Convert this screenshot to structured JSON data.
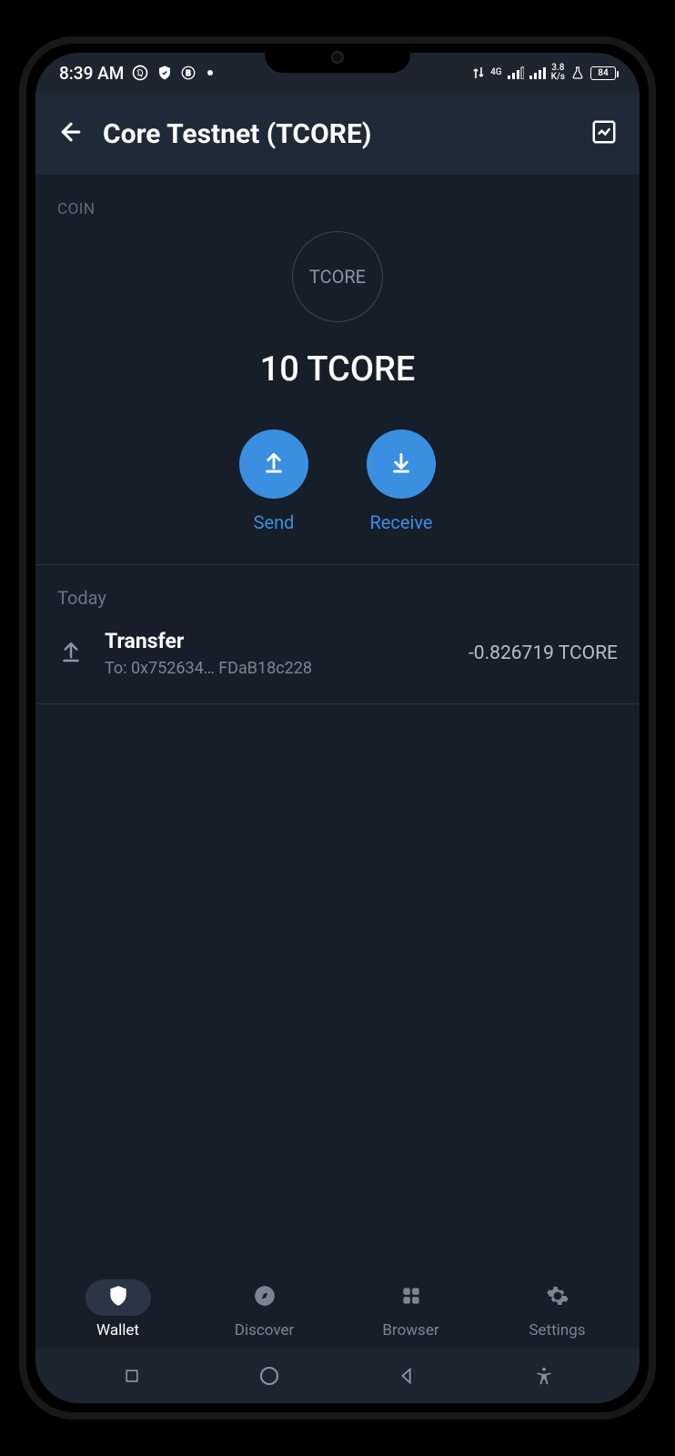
{
  "statusbar": {
    "time": "8:39 AM",
    "network_label": "4G",
    "data_rate": "3.8",
    "data_unit": "K/s",
    "battery": "84"
  },
  "header": {
    "title": "Core Testnet (TCORE)"
  },
  "coin": {
    "section_label": "COIN",
    "symbol": "TCORE",
    "balance": "10 TCORE"
  },
  "actions": {
    "send": "Send",
    "receive": "Receive"
  },
  "transactions": {
    "day_label": "Today",
    "items": [
      {
        "title": "Transfer",
        "subtitle": "To: 0x752634…  FDaB18c228",
        "amount": "-0.826719 TCORE"
      }
    ]
  },
  "bottom_nav": {
    "wallet": "Wallet",
    "discover": "Discover",
    "browser": "Browser",
    "settings": "Settings"
  }
}
